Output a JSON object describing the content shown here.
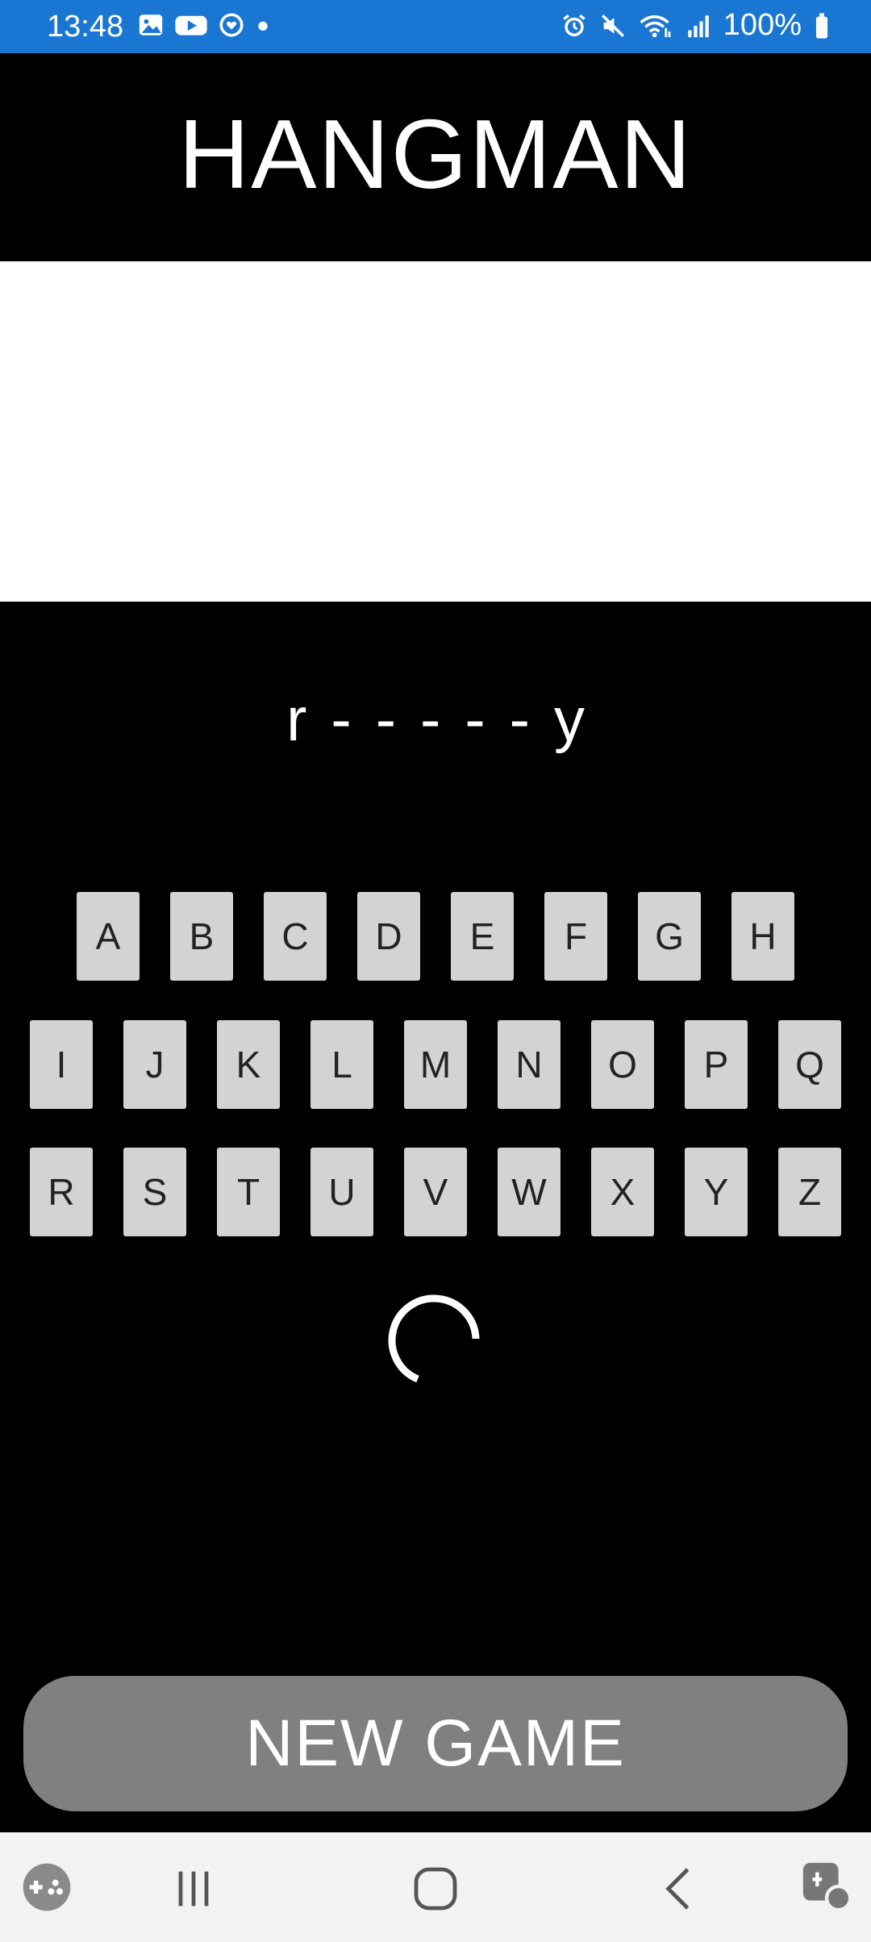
{
  "status_bar": {
    "time": "13:48",
    "battery": "100%",
    "icons": [
      "gallery-icon",
      "youtube-icon",
      "health-icon",
      "dot-icon",
      "alarm-icon",
      "mute-icon",
      "wifi-icon",
      "signal-icon",
      "battery-icon"
    ]
  },
  "app": {
    "title": "HANGMAN"
  },
  "word": {
    "letters": [
      "r",
      "-",
      "-",
      "-",
      "-",
      "-",
      "y"
    ]
  },
  "keyboard": {
    "row1": [
      "A",
      "B",
      "C",
      "D",
      "E",
      "F",
      "G",
      "H"
    ],
    "row2": [
      "I",
      "J",
      "K",
      "L",
      "M",
      "N",
      "O",
      "P",
      "Q"
    ],
    "row3": [
      "R",
      "S",
      "T",
      "U",
      "V",
      "W",
      "X",
      "Y",
      "Z"
    ]
  },
  "actions": {
    "new_game": "NEW GAME"
  },
  "nav_bar": {
    "icons": [
      "game-launcher-icon",
      "recents-icon",
      "home-icon",
      "back-icon",
      "accessibility-icon"
    ]
  }
}
